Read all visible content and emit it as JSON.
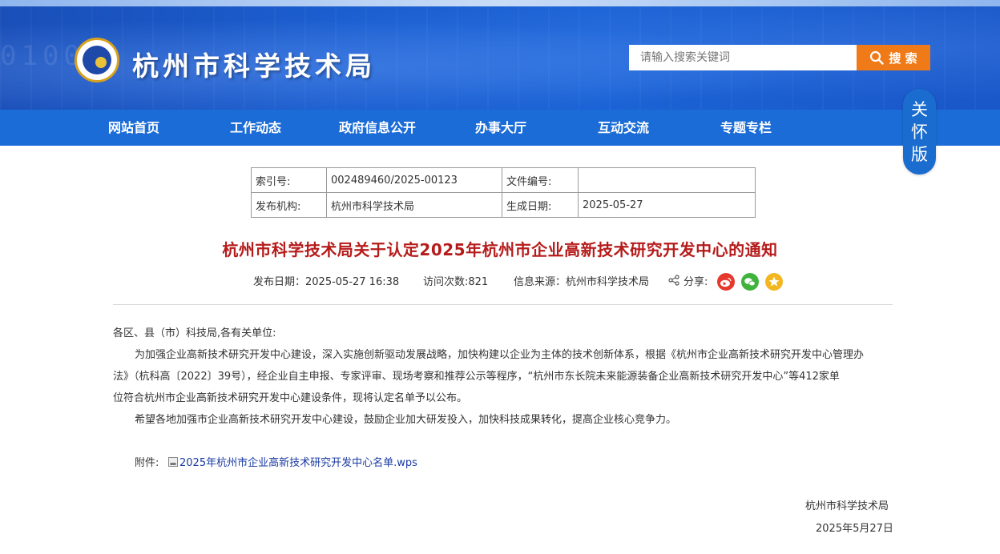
{
  "header": {
    "site_title": "杭州市科学技术局",
    "search_placeholder": "请输入搜索关键词",
    "search_button": "搜 索",
    "bg_digits": "01000"
  },
  "nav": [
    "网站首页",
    "工作动态",
    "政府信息公开",
    "办事大厅",
    "互动交流",
    "专题专栏"
  ],
  "care_button": "关怀版",
  "meta": {
    "index_label": "索引号:",
    "index_value": "002489460/2025-00123",
    "doc_no_label": "文件编号:",
    "doc_no_value": "",
    "org_label": "发布机构:",
    "org_value": "杭州市科学技术局",
    "date_label": "生成日期:",
    "date_value": "2025-05-27"
  },
  "article": {
    "title": "杭州市科学技术局关于认定2025年杭州市企业高新技术研究开发中心的通知",
    "publish": "发布日期：2025-05-27 16:38",
    "visits": "访问次数:821",
    "source": "信息来源：杭州市科学技术局",
    "share_label": "分享:",
    "greeting": "各区、县（市）科技局,各有关单位:",
    "para1_line1": "为加强企业高新技术研究开发中心建设，深入实施创新驱动发展战略，加快构建以企业为主体的技术创新体系，根据《杭州市企业高新技术研究开发中心管理办",
    "para1_line2": "法》（杭科高〔2022〕39号），经企业自主申报、专家评审、现场考察和推荐公示等程序，“杭州市东长院未来能源装备企业高新技术研究开发中心”等412家单",
    "para1_line3": "位符合杭州市企业高新技术研究开发中心建设条件，现将认定名单予以公布。",
    "para2": "希望各地加强市企业高新技术研究开发中心建设，鼓励企业加大研发投入，加快科技成果转化，提高企业核心竞争力。",
    "attach_label": "附件:",
    "attach_link": "2025年杭州市企业高新技术研究开发中心名单.wps",
    "sign_org": "杭州市科学技术局",
    "sign_date": "2025年5月27日"
  },
  "colors": {
    "nav_bg": "#1b6cd7",
    "title_red": "#b61b1b",
    "search_orange": "#f07a17",
    "weibo": "#e6382c",
    "wechat": "#3fb33b",
    "favorite": "#f2b620"
  }
}
